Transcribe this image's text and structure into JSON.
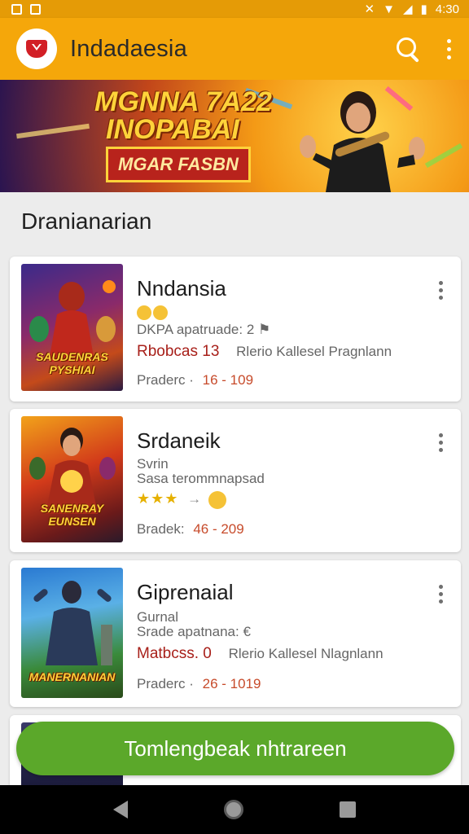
{
  "status_bar": {
    "time": "4:30"
  },
  "app_bar": {
    "title": "Indadaesia"
  },
  "banner": {
    "line1": "MGNNA 7A22",
    "line2": "INOPABAI",
    "cta": "MGAR FASBN"
  },
  "section_title": "Dranianarian",
  "games": [
    {
      "title": "Nndansia",
      "line1": "DKPA apatruade: 2 ⚑",
      "line2_red": "Rbobcаs 13",
      "line2_gray": "Rlerio Kallesel Pragnlann",
      "line3_label": "Praderc ·",
      "line3_value": "16 - 109",
      "thumb_label": "SAUDENRAS PYSHIAI"
    },
    {
      "title": "Srdaneik",
      "line1": "Svrin",
      "line2": "Sasa terommnapsad",
      "stars": "★★★",
      "line3_label": "Bradek:",
      "line3_value": "46 - 209",
      "thumb_label": "SANENRAY EUNSEN"
    },
    {
      "title": "Giprenaial",
      "line1": "Gurnal",
      "line2": "Srade apatnana: €",
      "line3_red": "Matbcѕs. 0",
      "line3_gray": "Rlerio Kallesel Nlagnlann",
      "line4_label": "Praderc ·",
      "line4_value": "26 - 1019",
      "thumb_label": "MANERNANIAN"
    }
  ],
  "cta": {
    "label": "Tomlengbeak nhtrareen"
  },
  "colors": {
    "app_bar": "#f5a70a",
    "status_bar": "#e59b06",
    "cta": "#5ba82a",
    "accent_red": "#a8201a"
  }
}
